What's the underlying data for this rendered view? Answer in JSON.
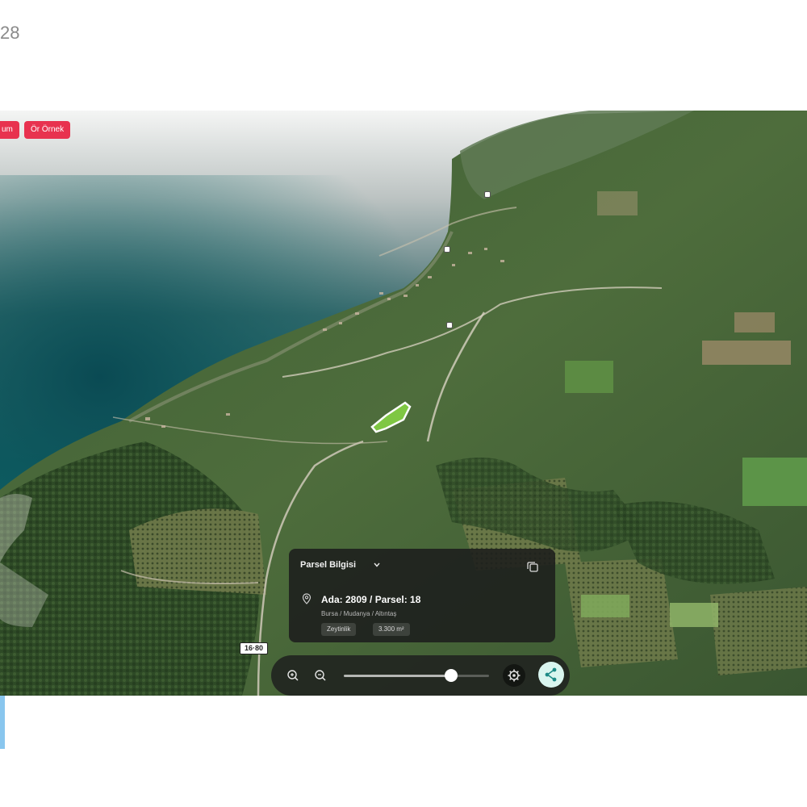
{
  "page": {
    "counter_text": "28"
  },
  "map": {
    "badges": [
      {
        "label": "um"
      },
      {
        "label": "Ör Örnek"
      }
    ],
    "road_labels": [
      {
        "text": ""
      },
      {
        "text": ""
      },
      {
        "text": ""
      },
      {
        "text": "16·80"
      }
    ]
  },
  "parcel_card": {
    "header": "Parsel Bilgisi",
    "title": "Ada: 2809 / Parsel: 18",
    "location": "Bursa / Mudanya / Altıntaş",
    "chips": [
      {
        "label": "Zeytinlik"
      },
      {
        "label": "3.300 m²"
      }
    ]
  },
  "toolbar": {
    "zoom_level": 0.74,
    "icons": [
      "zoom-in-icon",
      "zoom-out-icon",
      "settings-icon",
      "share-icon"
    ],
    "accent_color": "#d9f5ef"
  },
  "colors": {
    "badge": "#e8324f",
    "sea": "#0d5d63",
    "parcel_outline": "#ffffff",
    "parcel_fill": "#7fc743"
  }
}
